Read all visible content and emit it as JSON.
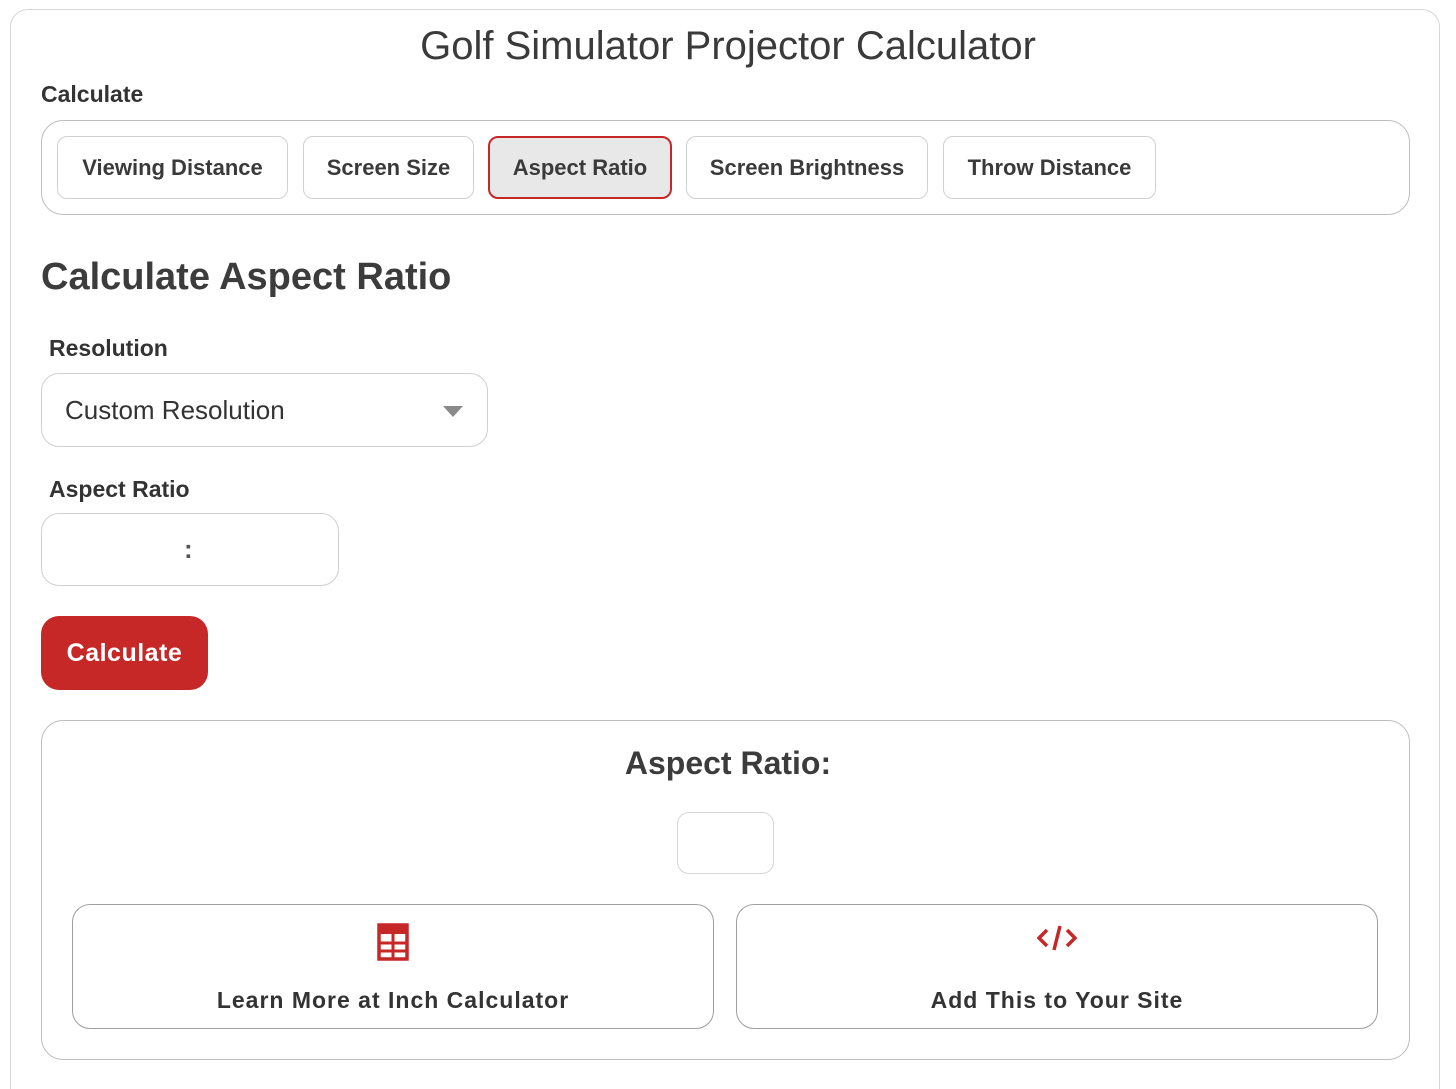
{
  "app": {
    "title": "Golf Simulator Projector Calculator"
  },
  "calculate_section": {
    "label": "Calculate",
    "tabs": [
      {
        "label": "Viewing Distance"
      },
      {
        "label": "Screen Size"
      },
      {
        "label": "Aspect Ratio",
        "active": true
      },
      {
        "label": "Screen Brightness"
      },
      {
        "label": "Throw Distance"
      }
    ]
  },
  "form": {
    "heading": "Calculate Aspect Ratio",
    "resolution": {
      "label": "Resolution",
      "selected": "Custom Resolution"
    },
    "aspect_ratio": {
      "label": "Aspect Ratio",
      "separator": ":",
      "width_value": "",
      "height_value": ""
    },
    "calculate_button": "Calculate"
  },
  "result": {
    "label": "Aspect Ratio:",
    "value": ""
  },
  "links": {
    "learn_more": {
      "label": "Learn More at Inch Calculator",
      "icon": "calculator-icon"
    },
    "add_to_site": {
      "label": "Add This to Your Site",
      "icon": "code-icon"
    }
  },
  "colors": {
    "accent": "#c62828",
    "border": "#bdbdbd",
    "tab_active_bg": "#e8e8e8",
    "text": "#333333"
  }
}
